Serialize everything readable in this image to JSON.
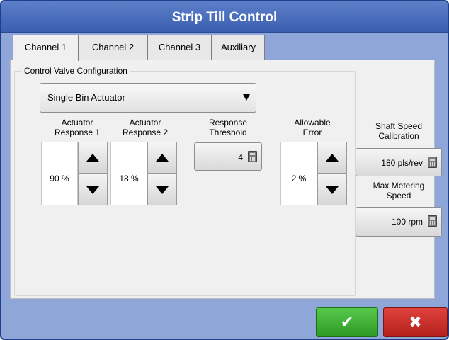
{
  "window": {
    "title": "Strip Till Control"
  },
  "tabs": [
    {
      "label": "Channel 1",
      "active": true
    },
    {
      "label": "Channel 2",
      "active": false
    },
    {
      "label": "Channel 3",
      "active": false
    },
    {
      "label": "Auxiliary",
      "active": false
    }
  ],
  "group": {
    "label": "Control Valve Configuration"
  },
  "valve_type": {
    "selected": "Single Bin Actuator"
  },
  "actuator_response_1": {
    "label_line1": "Actuator",
    "label_line2": "Response 1",
    "value": "90 %"
  },
  "actuator_response_2": {
    "label_line1": "Actuator",
    "label_line2": "Response 2",
    "value": "18 %"
  },
  "response_threshold": {
    "label_line1": "Response",
    "label_line2": "Threshold",
    "value": "4"
  },
  "allowable_error": {
    "label_line1": "Allowable",
    "label_line2": "Error",
    "value": "2 %"
  },
  "shaft_speed_calibration": {
    "label_line1": "Shaft Speed",
    "label_line2": "Calibration",
    "value": "180 pls/rev"
  },
  "max_metering_speed": {
    "label_line1": "Max Metering",
    "label_line2": "Speed",
    "value": "100 rpm"
  },
  "icons": {
    "increment": "up-arrow-icon",
    "decrement": "down-arrow-icon",
    "calculator": "calculator-icon",
    "ok": "checkmark-icon",
    "cancel": "x-icon"
  },
  "buttons": {
    "ok_glyph": "✔",
    "cancel_glyph": "✖"
  },
  "colors": {
    "title_bar": "#3b5fb0",
    "ok": "#3aa82f",
    "cancel": "#c62a25",
    "frame": "#8fa6d9"
  }
}
